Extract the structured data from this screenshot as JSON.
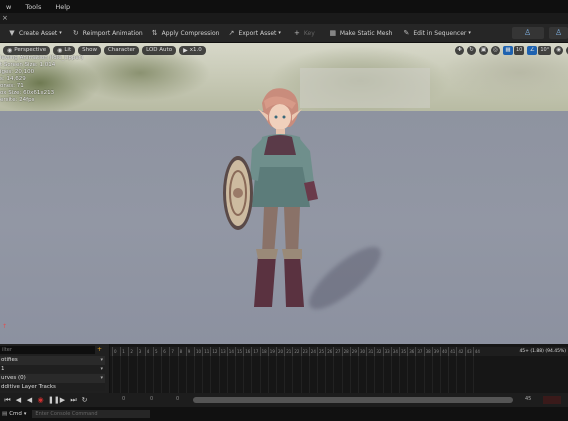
{
  "menu": {
    "items": [
      "w",
      "Tools",
      "Help"
    ]
  },
  "tab": {
    "close_glyph": "×"
  },
  "toolbar": {
    "create_asset": "Create Asset",
    "reimport": "Reimport Animation",
    "apply_compression": "Apply Compression",
    "export_asset": "Export Asset",
    "key": "Key",
    "make_static_mesh": "Make Static Mesh",
    "edit_in_sequencer": "Edit in Sequencer"
  },
  "viewport": {
    "perspective": "Perspective",
    "lit": "Lit",
    "show": "Show",
    "character": "Character",
    "lod_auto": "LOD Auto",
    "speed": "x1.0",
    "grid_snap": "10",
    "angle_snap": "10°",
    "overlay_lines": [
      "iewing Animation (Idle_Upper)",
      "t Screen Size: 1.014",
      "iges: 20,100",
      "s: 14,629",
      "ones: 71",
      "ox Size: 60x61x213",
      "ersite: 24fps"
    ],
    "axis_glyph": "↑"
  },
  "sequencer": {
    "search_placeholder": "ilter",
    "notifies": "otifies",
    "notify_track": "1",
    "curves": "urves (0)",
    "additive": "dditive Layer Tracks",
    "ticks": [
      "0",
      "1",
      "2",
      "3",
      "4",
      "5",
      "6",
      "7",
      "8",
      "9",
      "10",
      "11",
      "12",
      "13",
      "14",
      "15",
      "16",
      "17",
      "18",
      "19",
      "20",
      "21",
      "22",
      "23",
      "24",
      "25",
      "26",
      "27",
      "28",
      "29",
      "30",
      "31",
      "32",
      "33",
      "34",
      "35",
      "36",
      "37",
      "38",
      "39",
      "40",
      "41",
      "42",
      "43",
      "44"
    ],
    "frame_readout": "45+ (1.88) (94.45%)",
    "start_frame": "0",
    "start_frame2": "0",
    "zero_field": "0",
    "end_frame": "45"
  },
  "console": {
    "cmd": "Cmd",
    "placeholder": "Enter Console Command"
  }
}
